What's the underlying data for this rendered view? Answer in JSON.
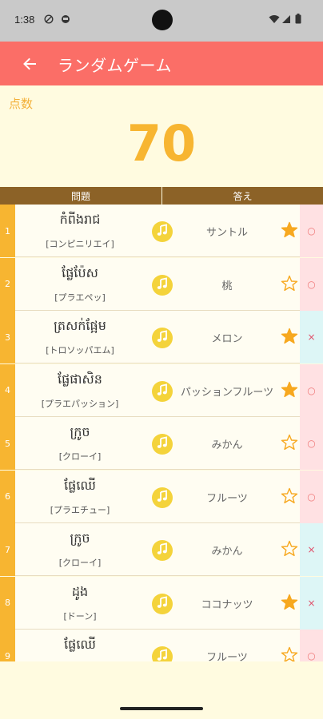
{
  "status": {
    "time": "1:38"
  },
  "app": {
    "title": "ランダムゲーム"
  },
  "score": {
    "label": "点数",
    "value": "70"
  },
  "table": {
    "question_header": "問題",
    "answer_header": "答え",
    "rows": [
      {
        "num": "1",
        "khmer": "កំពីងរាជ",
        "reading": "[コンピニリエイ]",
        "answer": "サントル",
        "starred": true,
        "result": "○"
      },
      {
        "num": "2",
        "khmer": "ផ្លែប៉ែស",
        "reading": "[プラエペッ]",
        "answer": "桃",
        "starred": false,
        "result": "○"
      },
      {
        "num": "3",
        "khmer": "ត្រសក់ផ្អែម",
        "reading": "[トロソッパエム]",
        "answer": "メロン",
        "starred": true,
        "result": "×"
      },
      {
        "num": "4",
        "khmer": "ផ្លែផាសិន",
        "reading": "[プラエパッション]",
        "answer": "パッションフルーツ",
        "starred": true,
        "result": "○"
      },
      {
        "num": "5",
        "khmer": "ក្រូច",
        "reading": "[クローイ]",
        "answer": "みかん",
        "starred": false,
        "result": "○"
      },
      {
        "num": "6",
        "khmer": "ផ្លែឈើ",
        "reading": "[プラエチュー]",
        "answer": "フルーツ",
        "starred": false,
        "result": "○"
      },
      {
        "num": "7",
        "khmer": "ក្រូច",
        "reading": "[クローイ]",
        "answer": "みかん",
        "starred": false,
        "result": "×"
      },
      {
        "num": "8",
        "khmer": "ដូង",
        "reading": "[ドーン]",
        "answer": "ココナッツ",
        "starred": true,
        "result": "×"
      },
      {
        "num": "9",
        "khmer": "ផ្លែឈើ",
        "reading": "",
        "answer": "フルーツ",
        "starred": false,
        "result": "○"
      }
    ]
  },
  "icons": {
    "back": "arrow-left-icon",
    "sound": "music-note-icon",
    "star_filled": "star-filled-icon",
    "star_outline": "star-outline-icon"
  },
  "colors": {
    "app_bar": "#fb6e67",
    "score": "#f7b531",
    "table_header": "#8c6227",
    "correct_bg": "#ffe1e3",
    "wrong_bg": "#ddf6f6",
    "background": "#fffbe0"
  }
}
